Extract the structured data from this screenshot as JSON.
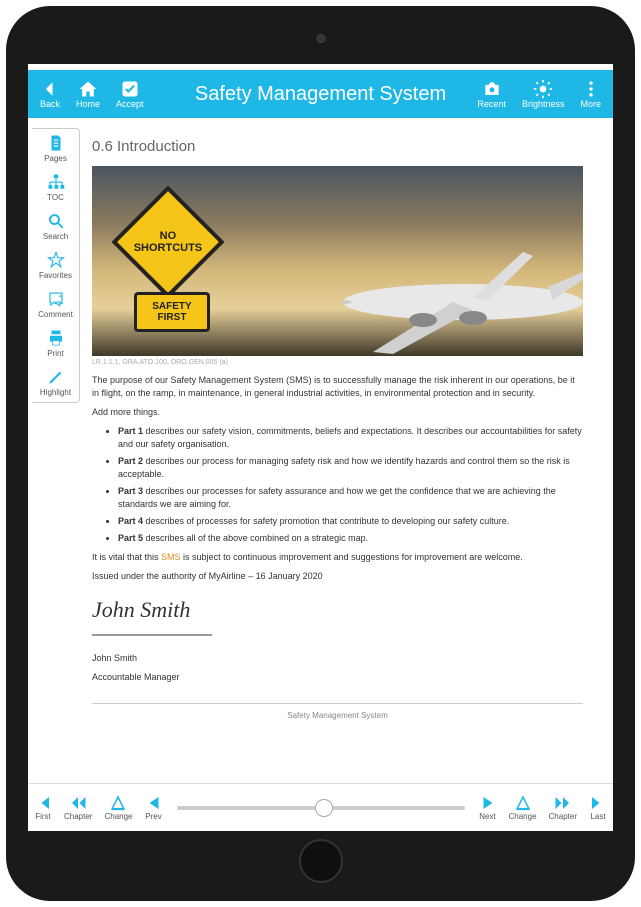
{
  "title": "Safety Management System",
  "topbar": {
    "left": [
      {
        "label": "Back",
        "icon": "arrow-left"
      },
      {
        "label": "Home",
        "icon": "home"
      },
      {
        "label": "Accept",
        "icon": "check-square"
      }
    ],
    "right": [
      {
        "label": "Recent",
        "icon": "camera"
      },
      {
        "label": "Brightness",
        "icon": "sun"
      },
      {
        "label": "More",
        "icon": "dots-v"
      }
    ]
  },
  "sidebar": [
    {
      "label": "Pages",
      "icon": "page"
    },
    {
      "label": "TOC",
      "icon": "sitemap"
    },
    {
      "label": "Search",
      "icon": "search"
    },
    {
      "label": "Favorites",
      "icon": "star"
    },
    {
      "label": "Comment",
      "icon": "comment"
    },
    {
      "label": "Print",
      "icon": "print"
    },
    {
      "label": "Highlight",
      "icon": "pencil"
    }
  ],
  "doc": {
    "heading": "0.6 Introduction",
    "sign1": "NO SHORTCUTS",
    "sign2": "SAFETY FIRST",
    "caption": "LR.1.1.1, ORA.ATO.100, ORO.GEN.005 (a)",
    "p1": "The purpose of our Safety Management System (SMS) is to successfully manage the risk inherent in our operations, be it in flight, on the ramp, in maintenance, in general industrial activities, in environmental protection and in security.",
    "p2": "Add more things.",
    "parts": [
      {
        "b": "Part 1",
        "t": " describes our safety vision, commitments, beliefs and expectations. It describes our accountabilities for safety and our safety organisation."
      },
      {
        "b": "Part 2",
        "t": " describes our process for managing safety risk and how we identify hazards and control them so the risk is acceptable."
      },
      {
        "b": "Part 3",
        "t": " describes our processes for safety assurance and how we get the confidence that we are achieving the standards we are aiming for."
      },
      {
        "b": "Part 4",
        "t": " describes of processes for safety promotion that contribute to developing our safety culture."
      },
      {
        "b": "Part 5",
        "t": " describes all of the above combined on a strategic map."
      }
    ],
    "p3a": "It is vital that this ",
    "p3b": "SMS",
    "p3c": " is subject to continuous improvement and suggestions for improvement are welcome.",
    "p4": "Issued under the authority of MyAirline – 16 January 2020",
    "signature": "John Smith",
    "name": "John Smith",
    "role": "Accountable Manager",
    "footer": "Safety Management System"
  },
  "bottombar": {
    "left": [
      {
        "label": "First",
        "icon": "first"
      },
      {
        "label": "Chapter",
        "icon": "rewind"
      },
      {
        "label": "Change",
        "icon": "delta-l"
      },
      {
        "label": "Prev",
        "icon": "tri-l"
      }
    ],
    "right": [
      {
        "label": "Next",
        "icon": "tri-r"
      },
      {
        "label": "Change",
        "icon": "delta-r"
      },
      {
        "label": "Chapter",
        "icon": "forward"
      },
      {
        "label": "Last",
        "icon": "last"
      }
    ]
  }
}
